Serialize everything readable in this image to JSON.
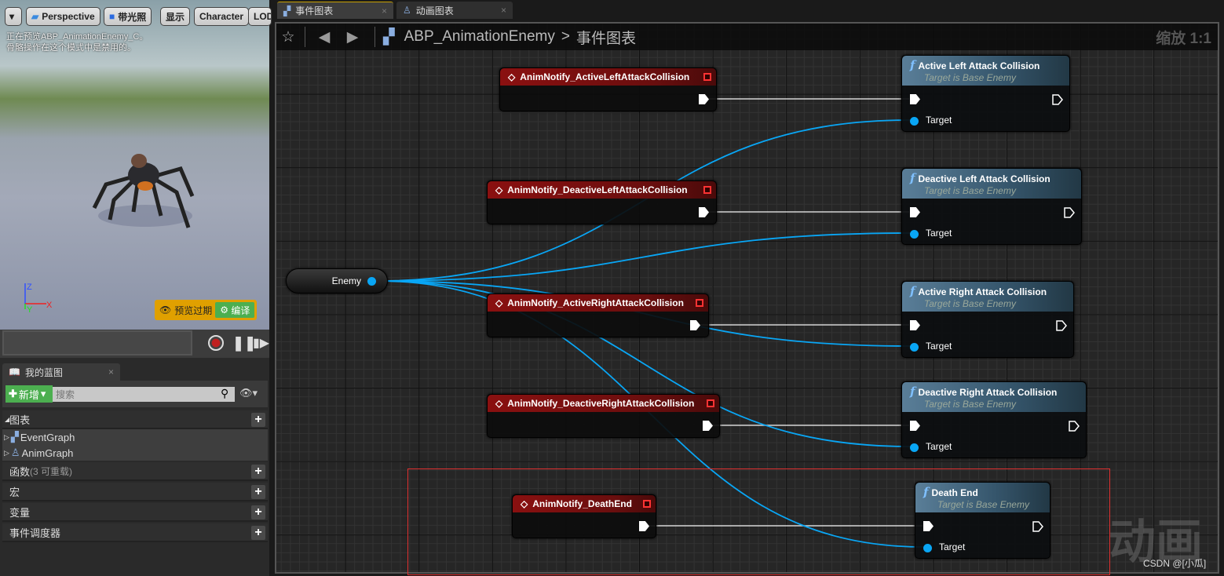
{
  "viewport": {
    "menu_label": "",
    "perspective": "Perspective",
    "lighting": "带光照",
    "show": "显示",
    "character": "Character",
    "lod": "LOD",
    "info_line1": "正在预览ABP_AnimationEnemy_C。",
    "info_line2": "骨骼操作在这个模式中是禁用的。",
    "axis_z": "Z",
    "axis_x": "X",
    "axis_y": "Y",
    "preview_expired": "预览过期",
    "compile": "编译"
  },
  "blueprint_panel": {
    "tab": "我的蓝图",
    "add_new": "新增",
    "search_placeholder": "搜索",
    "sections": [
      {
        "label": "图表",
        "items": [
          "EventGraph",
          "AnimGraph"
        ]
      },
      {
        "label": "函数",
        "note": "(3 可重载)"
      },
      {
        "label": "宏"
      },
      {
        "label": "变量"
      },
      {
        "label": "事件调度器"
      }
    ]
  },
  "tabs": [
    {
      "label": "事件图表",
      "active": true
    },
    {
      "label": "动画图表",
      "active": false
    }
  ],
  "breadcrumb": {
    "blueprint": "ABP_AnimationEnemy",
    "separator": ">",
    "graph": "事件图表"
  },
  "zoom_label": "缩放 1:1",
  "watermark": "动画",
  "credit": "CSDN @[小瓜]",
  "variable_node": {
    "label": "Enemy"
  },
  "notify_nodes": [
    "AnimNotify_ActiveLeftAttackCollision",
    "AnimNotify_DeactiveLeftAttackCollision",
    "AnimNotify_ActiveRightAttackCollision",
    "AnimNotify_DeactiveRightAttackCollision",
    "AnimNotify_DeathEnd"
  ],
  "function_nodes": [
    {
      "title": "Active Left Attack Collision",
      "subtitle": "Target is Base Enemy",
      "pin": "Target"
    },
    {
      "title": "Deactive Left Attack Collision",
      "subtitle": "Target is Base Enemy",
      "pin": "Target"
    },
    {
      "title": "Active Right Attack Collision",
      "subtitle": "Target is Base Enemy",
      "pin": "Target"
    },
    {
      "title": "Deactive Right Attack Collision",
      "subtitle": "Target is Base Enemy",
      "pin": "Target"
    },
    {
      "title": "Death End",
      "subtitle": "Target is Base Enemy",
      "pin": "Target"
    }
  ],
  "colors": {
    "object_wire": "#09a6f5",
    "exec_wire": "#ffffff",
    "event_header": "#8a1010",
    "function_header": "#5a7e98",
    "comment_box": "#e03030",
    "compile": "#4caf50",
    "preview_badge": "#e0a000"
  }
}
